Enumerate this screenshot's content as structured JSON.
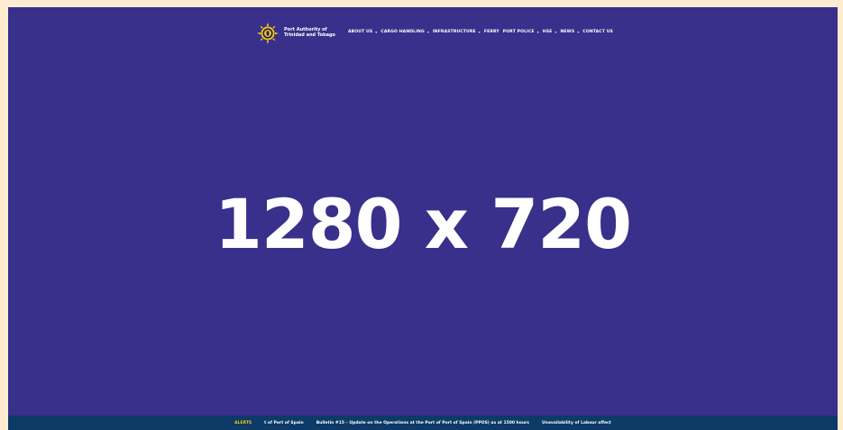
{
  "header": {
    "logo_icon": "port-authority-seal-icon",
    "org_name_line1": "Port Authority of",
    "org_name_line2": "Trinidad and Tobago"
  },
  "nav": {
    "items": [
      {
        "label": "ABOUT US",
        "has_dropdown": true
      },
      {
        "label": "CARGO HANDLING",
        "has_dropdown": true
      },
      {
        "label": "INFRASTRUCTURE",
        "has_dropdown": true
      },
      {
        "label": "FERRY",
        "has_dropdown": false
      },
      {
        "label": "PORT POLICE",
        "has_dropdown": true
      },
      {
        "label": "HSE",
        "has_dropdown": true
      },
      {
        "label": "NEWS",
        "has_dropdown": true
      },
      {
        "label": "CONTACT US",
        "has_dropdown": false
      }
    ]
  },
  "hero": {
    "text": "1280 x 720"
  },
  "alerts": {
    "label": "ALERTS",
    "items": [
      "t of Port of Spain",
      "Bulletin #15 – Update on the Operations at the Port of Port of Spain (PPOS) as at 1500 hours",
      "Unavailability of Labour affect"
    ]
  },
  "colors": {
    "page_background": "#fdecd2",
    "hero_background": "#38308a",
    "footer_background": "#0d3a66",
    "alert_accent": "#f5c21b",
    "text": "#ffffff"
  }
}
